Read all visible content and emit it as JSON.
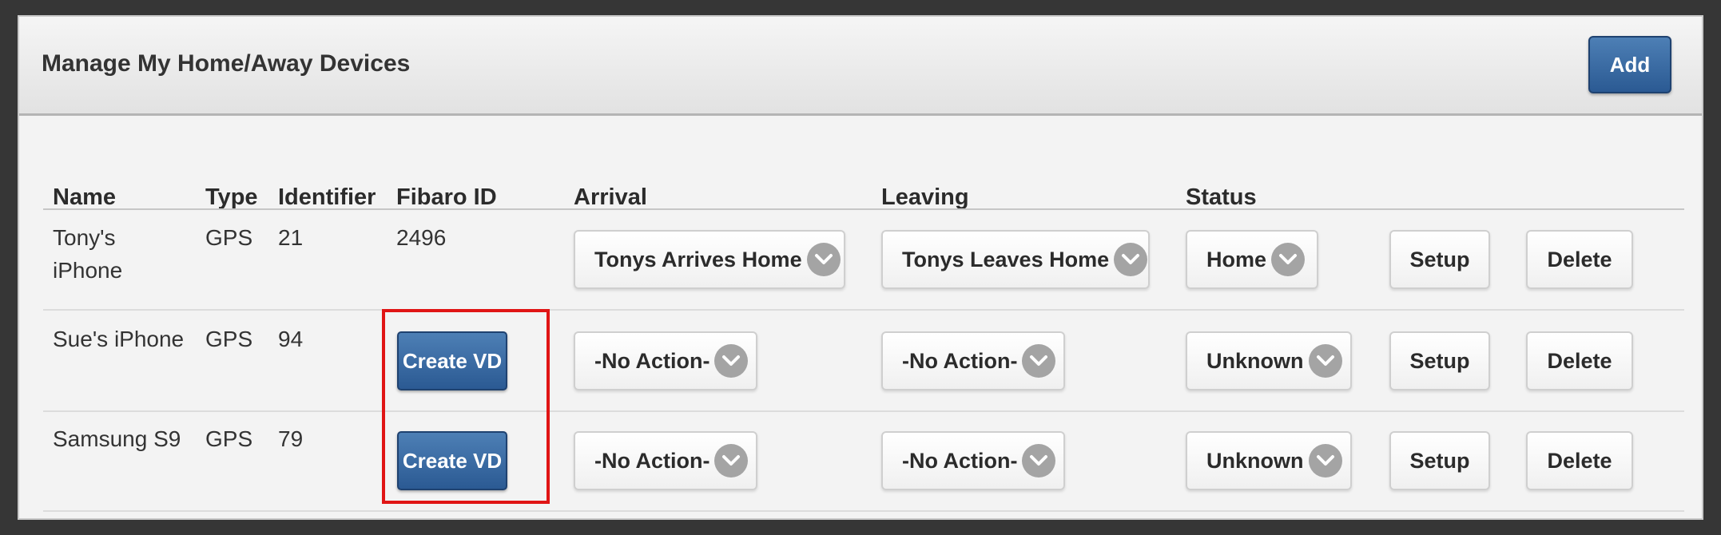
{
  "panel": {
    "title": "Manage My Home/Away Devices",
    "add_label": "Add"
  },
  "table": {
    "headers": [
      "Name",
      "Type",
      "Identifier",
      "Fibaro ID",
      "Arrival",
      "Leaving",
      "Status"
    ],
    "rows": [
      {
        "name_line1": "Tony's",
        "name_line2": "iPhone",
        "type": "GPS",
        "identifier": "21",
        "fibaro_id": "2496",
        "arrival": "Tonys Arrives Home",
        "leaving": "Tonys Leaves Home",
        "status": "Home",
        "setup_label": "Setup",
        "delete_label": "Delete"
      },
      {
        "name_line1": "Sue's iPhone",
        "type": "GPS",
        "identifier": "94",
        "create_vd_label": "Create VD",
        "arrival": "-No Action-",
        "leaving": "-No Action-",
        "status": "Unknown",
        "setup_label": "Setup",
        "delete_label": "Delete"
      },
      {
        "name_line1": "Samsung S9",
        "type": "GPS",
        "identifier": "79",
        "create_vd_label": "Create VD",
        "arrival": "-No Action-",
        "leaving": "-No Action-",
        "status": "Unknown",
        "setup_label": "Setup",
        "delete_label": "Delete"
      }
    ]
  },
  "colors": {
    "primary_button": "#2b5a93",
    "highlight": "#e01515",
    "chevron_badge": "#a4a4a4"
  },
  "icons": {
    "dropdown": "chevron-down-icon"
  }
}
